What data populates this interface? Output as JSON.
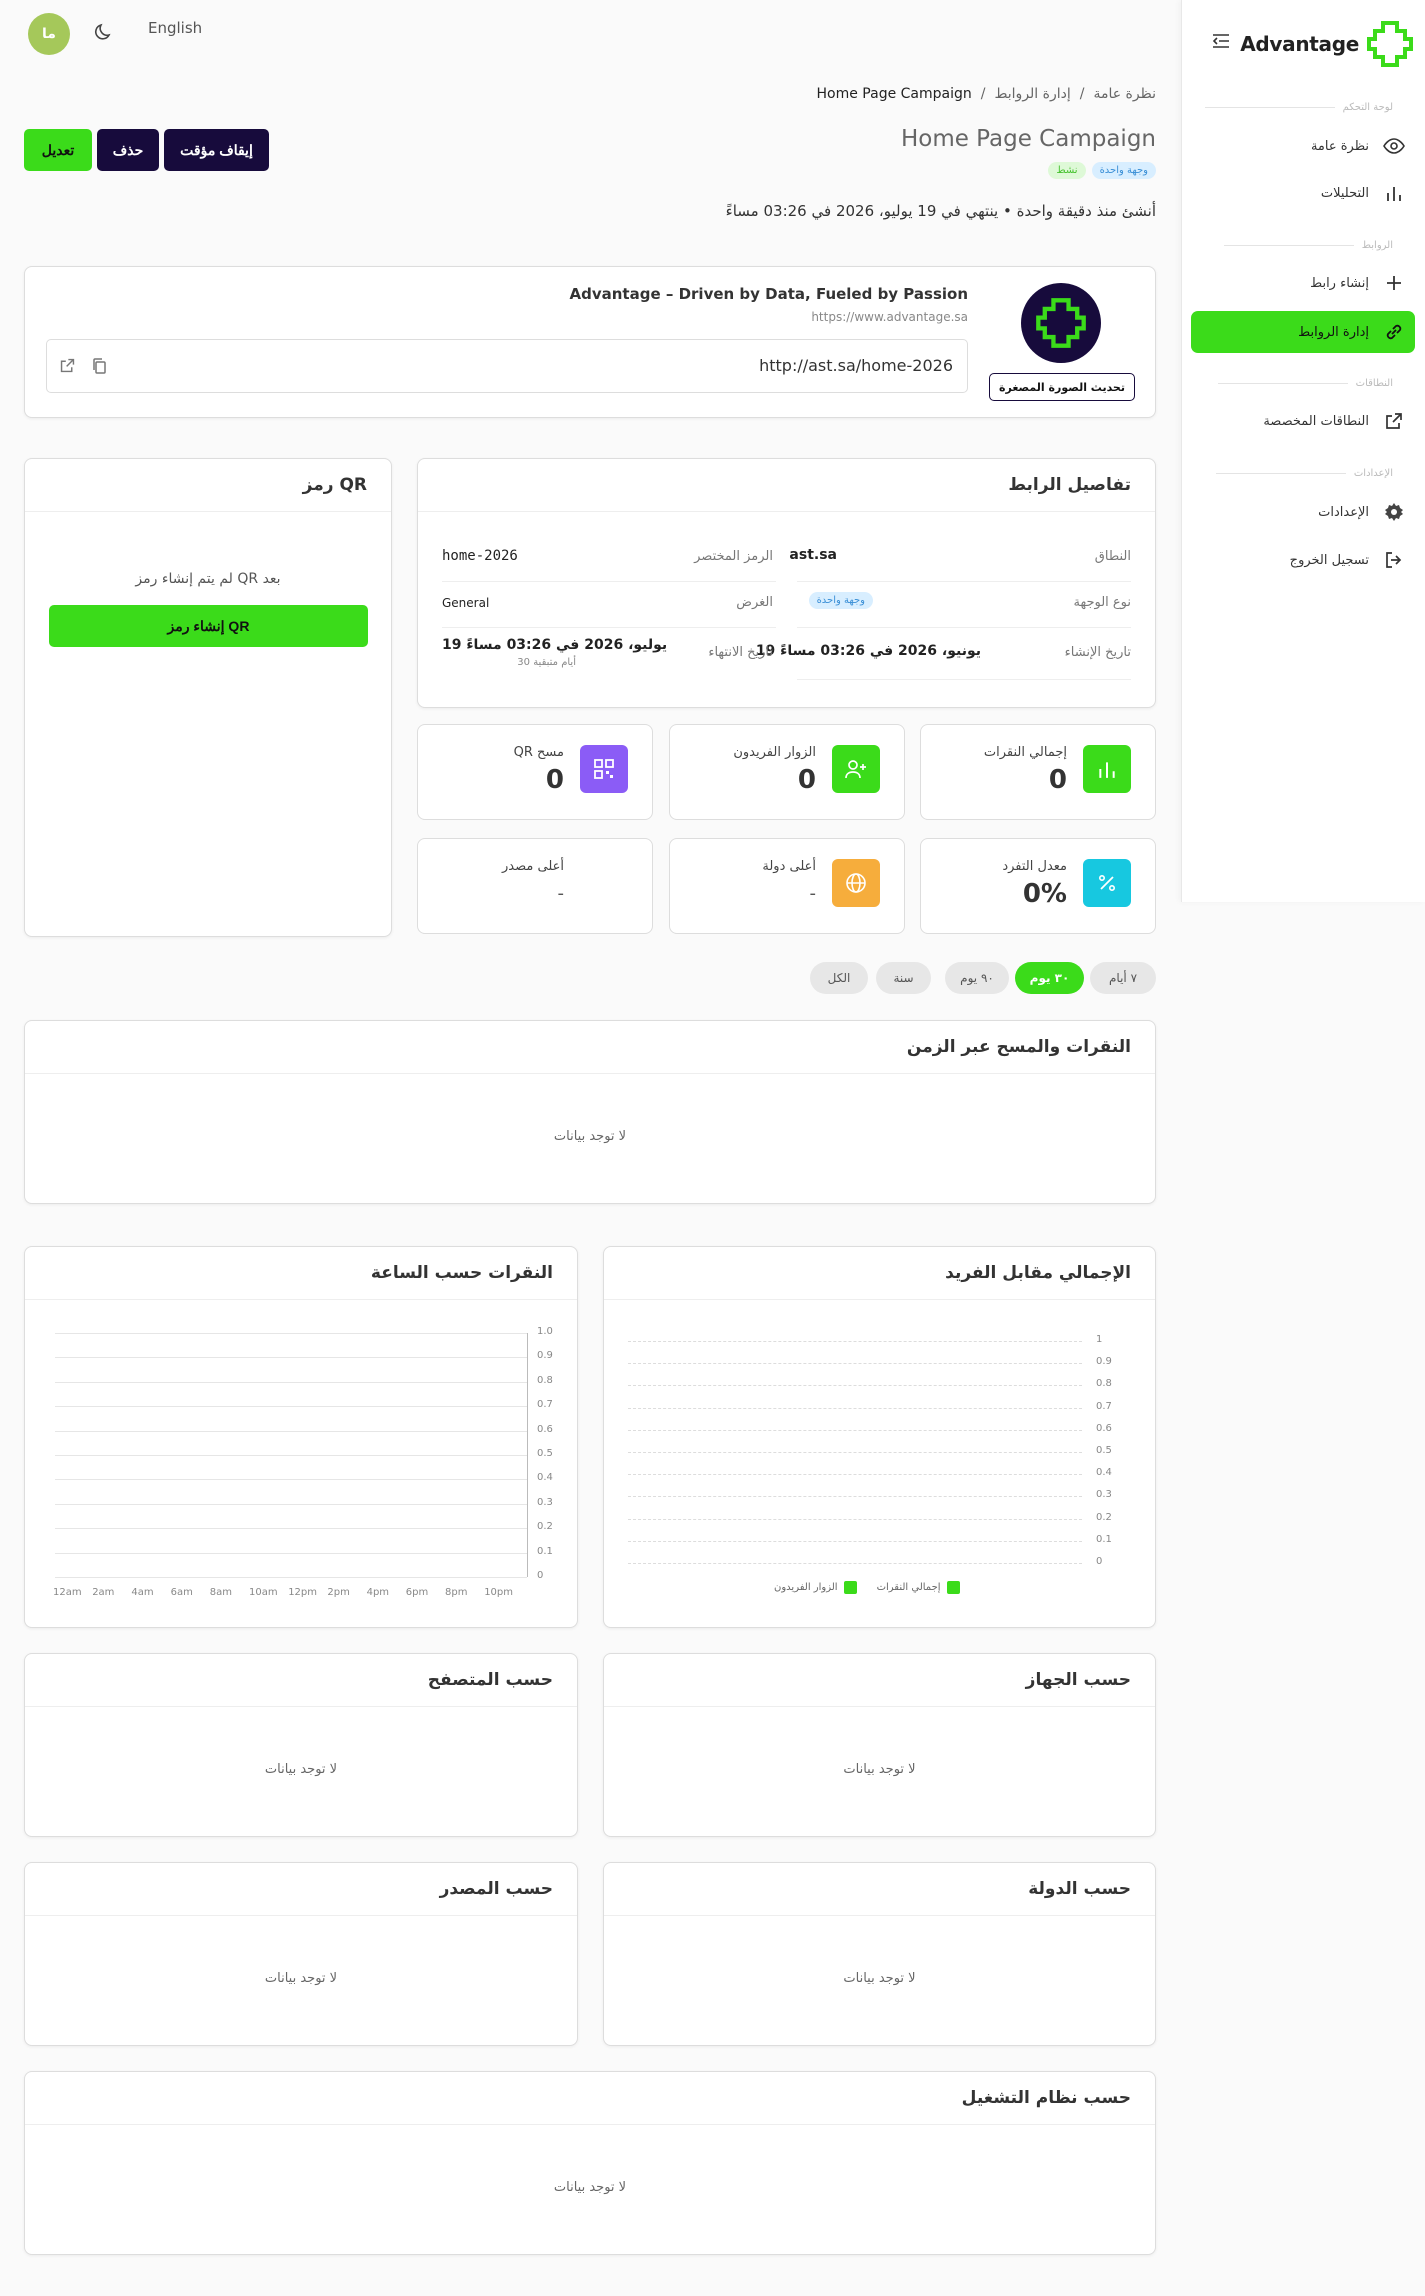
{
  "sidebar": {
    "logo_text": "Advantage",
    "sections": [
      {
        "label": "لوحة التحكم"
      },
      {
        "label": "الروابط"
      },
      {
        "label": "النطاقات"
      },
      {
        "label": "الإعدادات"
      }
    ],
    "items": [
      {
        "label": "نظرة عامة",
        "icon": "eye-icon"
      },
      {
        "label": "التحليلات",
        "icon": "bar-chart-icon"
      },
      {
        "label": "إنشاء رابط",
        "icon": "plus-icon"
      },
      {
        "label": "إدارة الروابط",
        "icon": "link-icon",
        "active": true
      },
      {
        "label": "النطاقات المخصصة",
        "icon": "external-link-icon"
      },
      {
        "label": "الإعدادات",
        "icon": "gear-icon"
      },
      {
        "label": "تسجيل الخروج",
        "icon": "logout-icon"
      }
    ],
    "accent_color": "#3bdb1a"
  },
  "topbar": {
    "avatar_initials": "ما",
    "language": "English"
  },
  "breadcrumb": [
    "نظرة عامة",
    "إدارة الروابط",
    "Home Page Campaign"
  ],
  "header": {
    "title": "Home Page Campaign",
    "badges": [
      "وجهة واحدة",
      "نشط"
    ],
    "created_text": "أنشئ منذ دقيقة واحدة • ينتهي في 19 يوليو، 2026 في 03:26 مساءً",
    "buttons": {
      "pause": "إيقاف مؤقت",
      "delete": "حذف",
      "edit": "تعديل"
    }
  },
  "link_preview": {
    "title": "Advantage – Driven by Data, Fueled by Passion",
    "url": "https://www.advantage.sa",
    "short_url": "http://ast.sa/home-2026",
    "update_thumbnail": "تحديث الصورة المصغرة"
  },
  "link_details": {
    "title": "تفاصيل الرابط",
    "domain_label": "النطاق",
    "domain": "ast.sa",
    "short_code_label": "الرمز المختصر",
    "short_code": "home-2026",
    "dest_type_label": "نوع الوجهة",
    "dest_type": "وجهة واحدة",
    "purpose_label": "الغرض",
    "purpose": "General",
    "created_label": "تاريخ الإنشاء",
    "created": "19 يونيو، 2026 في 03:26 مساءً",
    "expiry_label": "تاريخ الانتهاء",
    "expiry": "19 يوليو، 2026 في 03:26 مساءً",
    "days_left": "30 أيام متبقية"
  },
  "qr": {
    "title": "رمز QR",
    "empty": "لم يتم إنشاء رمز QR بعد",
    "button": "إنشاء رمز QR"
  },
  "stats": [
    {
      "label": "إجمالي النقرات",
      "value": "0",
      "color": "#3bdb1a",
      "icon": "bar-chart-icon"
    },
    {
      "label": "الزوار الفريدون",
      "value": "0",
      "color": "#3bdb1a",
      "icon": "user-plus-icon"
    },
    {
      "label": "مسح QR",
      "value": "0",
      "color": "#8b5cf6",
      "icon": "qr-icon"
    },
    {
      "label": "معدل التفرد",
      "value": "0%",
      "color": "#17c8e0",
      "icon": "percent-icon"
    },
    {
      "label": "أعلى دولة",
      "value": "-",
      "color": "#f6ad3c",
      "icon": "globe-icon"
    },
    {
      "label": "أعلى مصدر",
      "value": "-"
    }
  ],
  "ranges": [
    "٧ أيام",
    "٣٠ يوم",
    "٩٠ يوم",
    "سنة",
    "الكل"
  ],
  "active_range": "٣٠ يوم",
  "charts": {
    "timeline_title": "النقرات والمسح عبر الزمن",
    "no_data": "لا توجد بيانات",
    "total_vs_unique_title": "الإجمالي مقابل الفريد",
    "hourly_title": "النقرات حسب الساعة",
    "device_title": "حسب الجهاز",
    "browser_title": "حسب المتصفح",
    "country_title": "حسب الدولة",
    "source_title": "حسب المصدر",
    "os_title": "حسب نظام التشغيل"
  },
  "chart_data": [
    {
      "type": "bar",
      "title": "الإجمالي مقابل الفريد",
      "series": [
        {
          "name": "إجمالي النقرات",
          "values": []
        },
        {
          "name": "الزوار الفريدون",
          "values": []
        }
      ],
      "y_ticks": [
        "1",
        "0.9",
        "0.8",
        "0.7",
        "0.6",
        "0.5",
        "0.4",
        "0.3",
        "0.2",
        "0.1",
        "0"
      ],
      "ylim": [
        0,
        1
      ],
      "grid": true,
      "legend": "bottom"
    },
    {
      "type": "bar",
      "title": "النقرات حسب الساعة",
      "categories": [
        "12am",
        "2am",
        "4am",
        "6am",
        "8am",
        "10am",
        "12pm",
        "2pm",
        "4pm",
        "6pm",
        "8pm",
        "10pm"
      ],
      "values": [],
      "y_ticks": [
        "1.0",
        "0.9",
        "0.8",
        "0.7",
        "0.6",
        "0.5",
        "0.4",
        "0.3",
        "0.2",
        "0.1",
        "0"
      ],
      "ylim": [
        0,
        1
      ],
      "grid": true
    }
  ]
}
